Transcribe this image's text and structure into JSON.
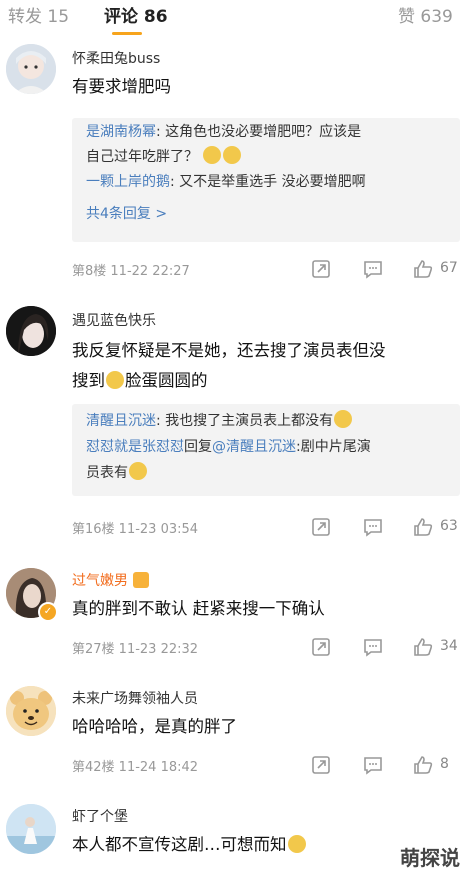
{
  "tabs": {
    "reposts": "转发 15",
    "comments": "评论 86",
    "likes": "赞 639"
  },
  "comments": [
    {
      "user": "怀柔田兔buss",
      "text": "有要求增肥吗",
      "replies": [
        {
          "name": "是湖南杨幂",
          "text": ": 这角色也没必要增肥吧？应该是",
          "text2": "自己过年吃胖了？"
        },
        {
          "name": "一颗上岸的鹅",
          "text": ": 又不是举重选手 没必要增肥啊"
        }
      ],
      "more": "共4条回复 >",
      "floor": "第8楼  11-22 22:27",
      "likes": "67"
    },
    {
      "user": "遇见蓝色快乐",
      "text1": "我反复怀疑是不是她，还去搜了演员表但没",
      "text2a": "搜到",
      "text2b": "脸蛋圆圆的",
      "replies": [
        {
          "name": "清醒且沉迷",
          "text": ": 我也搜了主演员表上都没有"
        },
        {
          "name": "怼怼就是张怼怼",
          "mid": "回复",
          "name2": "@清醒且沉迷",
          "text": ":剧中片尾演",
          "text2": "员表有"
        }
      ],
      "floor": "第16楼  11-23 03:54",
      "likes": "63"
    },
    {
      "user": "过气嫩男",
      "text": "真的胖到不敢认 赶紧来搜一下确认",
      "floor": "第27楼  11-23 22:32",
      "likes": "34"
    },
    {
      "user": "未来广场舞领袖人员",
      "text": "哈哈哈哈，是真的胖了",
      "floor": "第42楼  11-24 18:42",
      "likes": "8"
    },
    {
      "user": "虾了个堡",
      "text": "本人都不宣传这剧…可想而知"
    }
  ],
  "watermark": "萌探说",
  "colors": {
    "link": "#4a7ebd",
    "vip_name": "#f26d1e",
    "tab_underline": "#f7a41c",
    "reply_bg": "#f3f3f3"
  },
  "icons": [
    "share-icon",
    "comment-icon",
    "like-icon"
  ]
}
